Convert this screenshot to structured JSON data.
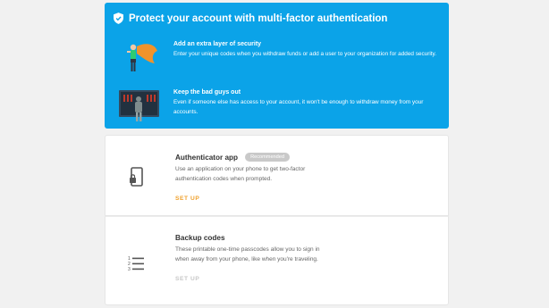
{
  "banner": {
    "title": "Protect your account with multi-factor authentication",
    "features": [
      {
        "title": "Add an extra layer of security",
        "description": "Enter your unique codes when you withdraw funds or add a user to your organization for added security."
      },
      {
        "title": "Keep the bad guys out",
        "description": "Even if someone else has access to your account, it won't be enough to withdraw money from your accounts."
      }
    ]
  },
  "methods": [
    {
      "title": "Authenticator app",
      "badge": "Recommended",
      "description": "Use an application on your phone to get two-factor authentication codes when prompted.",
      "action": "SET UP",
      "icon": "phone-lock-icon"
    },
    {
      "title": "Backup codes",
      "description": "These printable one-time passcodes allow you to sign in when away from your phone, like when you're traveling.",
      "action": "SET UP",
      "icon": "numbered-list-icon"
    }
  ],
  "colors": {
    "banner": "#0ba3e8",
    "action_active": "#f0a02b",
    "action_inactive": "#c7c7c7",
    "badge": "#c9c9c9"
  }
}
